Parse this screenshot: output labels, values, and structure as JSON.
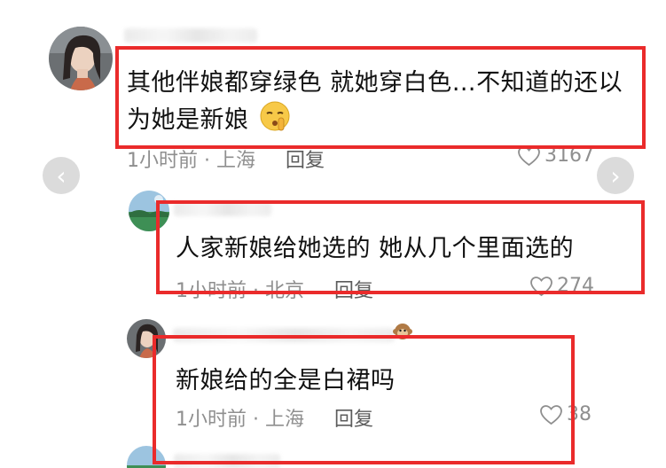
{
  "comments": [
    {
      "text_line1": "其他伴娘都穿绿色 就她穿白色…不知道的还以",
      "text_line2": "为她是新娘",
      "emoji": "shushing-face-emoji",
      "time_location": "1小时前 · 上海",
      "reply_label": "回复",
      "likes": "3167"
    },
    {
      "text": "人家新娘给她选的 她从几个里面选的",
      "time_location": "1小时前 · 北京",
      "reply_label": "回复",
      "likes": "274"
    },
    {
      "text": "新娘给的全是白裙吗",
      "time_location": "1小时前 · 上海",
      "reply_label": "回复",
      "likes": "38"
    }
  ],
  "nav": {
    "prev_icon": "‹",
    "next_icon": "›"
  },
  "colors": {
    "highlight_box": "#ea2b2b",
    "meta_gray": "#8f8f8f",
    "text": "#111111"
  }
}
